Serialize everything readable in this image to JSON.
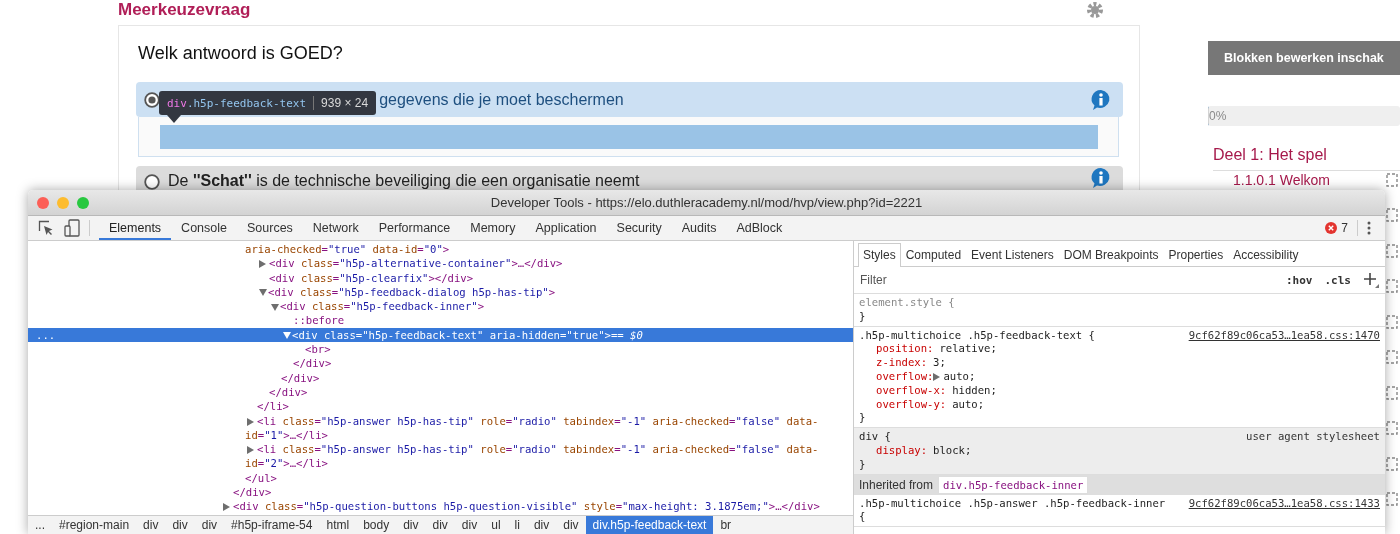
{
  "page": {
    "heading": "Meerkeuzevraag"
  },
  "question": {
    "title": "Welk antwoord is GOED?",
    "answers": [
      {
        "text": "gegevens die je moet beschermen",
        "selected": true,
        "inspector_tooltip": {
          "selector": "div.h5p-feedback-text",
          "size": "939 × 24"
        }
      },
      {
        "text": "De **''Schat''** is de technische beveiliging die een organisatie neemt",
        "selected": false
      }
    ]
  },
  "sidebar": {
    "edit_button": "Blokken bewerken inschak",
    "progress": {
      "level": 0,
      "label": "0%"
    },
    "section_title": "Deel 1: Het spel",
    "lessons": [
      {
        "label": "1.1.0.1 Welkom"
      }
    ]
  },
  "devtools": {
    "title": "Developer Tools - https://elo.duthleracademy.nl/mod/hvp/view.php?id=2221",
    "tabs": [
      {
        "label": "Elements",
        "selected": true
      },
      {
        "label": "Console",
        "selected": false
      },
      {
        "label": "Sources",
        "selected": false
      },
      {
        "label": "Network",
        "selected": false
      },
      {
        "label": "Performance",
        "selected": false
      },
      {
        "label": "Memory",
        "selected": false
      },
      {
        "label": "Application",
        "selected": false
      },
      {
        "label": "Security",
        "selected": false
      },
      {
        "label": "Audits",
        "selected": false
      },
      {
        "label": "AdBlock",
        "selected": false
      }
    ],
    "error_count": "7",
    "dom_tree": [
      {
        "selected": false,
        "close": "</div>",
        "children": [
          {
            "selected": false,
            "close": "</ul>",
            "children": [
              {
                "open": "aria-checked=\"true\" data-id=\"0\">",
                "continued": true,
                "selected": false,
                "close": "</li>",
                "children": [
                  {
                    "open": "<div class=\"h5p-alternative-container\">…</div>",
                    "expanded": false,
                    "selected": false
                  },
                  {
                    "open": "<div class=\"h5p-clearfix\"></div>",
                    "selected": false
                  },
                  {
                    "open": "<div class=\"h5p-feedback-dialog h5p-has-tip\">",
                    "expanded": true,
                    "selected": false,
                    "close": "</div>",
                    "children": [
                      {
                        "open": "<div class=\"h5p-feedback-inner\">",
                        "expanded": true,
                        "selected": false,
                        "close": "</div>",
                        "children": [
                          {
                            "open": "::before",
                            "selected": false
                          },
                          {
                            "open": "<div class=\"h5p-feedback-text\" aria-hidden=\"true\">",
                            "note": "== $0",
                            "gutter": "...",
                            "expanded": true,
                            "selected": true,
                            "close": "</div>",
                            "children": [
                              {
                                "open": "<br>",
                                "selected": false
                              }
                            ]
                          }
                        ]
                      }
                    ]
                  }
                ]
              },
              {
                "open": "<li class=\"h5p-answer h5p-has-tip\" role=\"radio\" tabindex=\"-1\" aria-checked=\"false\" data-id=\"1\">…</li>",
                "expanded": false,
                "selected": false
              },
              {
                "open": "<li class=\"h5p-answer h5p-has-tip\" role=\"radio\" tabindex=\"-1\" aria-checked=\"false\" data-id=\"2\">…</li>",
                "expanded": false,
                "selected": false
              }
            ]
          }
        ]
      },
      {
        "open": "<div class=\"h5p-question-buttons h5p-question-visible\" style=\"max-height: 3.1875em;\">…</div>",
        "expanded": false,
        "selected": false
      }
    ],
    "breadcrumbs": [
      {
        "label": "...",
        "selected": false
      },
      {
        "label": "#region-main",
        "selected": false
      },
      {
        "label": "div",
        "selected": false
      },
      {
        "label": "div",
        "selected": false
      },
      {
        "label": "div",
        "selected": false
      },
      {
        "label": "#h5p-iframe-54",
        "selected": false
      },
      {
        "label": "html",
        "selected": false
      },
      {
        "label": "body",
        "selected": false
      },
      {
        "label": "div",
        "selected": false
      },
      {
        "label": "div",
        "selected": false
      },
      {
        "label": "div",
        "selected": false
      },
      {
        "label": "ul",
        "selected": false
      },
      {
        "label": "li",
        "selected": false
      },
      {
        "label": "div",
        "selected": false
      },
      {
        "label": "div",
        "selected": false
      },
      {
        "label": "div.h5p-feedback-text",
        "selected": true
      },
      {
        "label": "br",
        "selected": false
      }
    ],
    "sidebar_tabs": [
      {
        "label": "Styles",
        "selected": true
      },
      {
        "label": "Computed",
        "selected": false
      },
      {
        "label": "Event Listeners",
        "selected": false
      },
      {
        "label": "DOM Breakpoints",
        "selected": false
      },
      {
        "label": "Properties",
        "selected": false
      },
      {
        "label": "Accessibility",
        "selected": false
      }
    ],
    "filter": {
      "placeholder": "Filter",
      "hov": ":hov",
      "cls": ".cls"
    },
    "style_rules": [
      {
        "kind": "inline",
        "selector": "element.style {",
        "close": "}"
      },
      {
        "kind": "author",
        "selector": ".h5p-multichoice .h5p-feedback-text {",
        "source": "9cf62f89c06ca53…1ea58.css:1470",
        "properties": [
          {
            "name": "position:",
            "value": "relative;",
            "expandable": false
          },
          {
            "name": "z-index:",
            "value": "3;",
            "expandable": false
          },
          {
            "name": "overflow:",
            "value": "auto;",
            "expandable": true
          },
          {
            "name": "overflow-x:",
            "value": "hidden;",
            "expandable": false
          },
          {
            "name": "overflow-y:",
            "value": "auto;",
            "expandable": false
          }
        ],
        "close": "}"
      },
      {
        "kind": "user_agent",
        "selector": "div {",
        "source": "user agent stylesheet",
        "properties": [
          {
            "name": "display:",
            "value": "block;",
            "expandable": false
          }
        ],
        "close": "}"
      },
      {
        "kind": "inherited_header",
        "label": "Inherited from",
        "element": "div.h5p-feedback-inner"
      },
      {
        "kind": "author",
        "selector": ".h5p-multichoice .h5p-answer .h5p-feedback-inner {",
        "source": "9cf62f89c06ca53…1ea58.css:1433"
      }
    ]
  }
}
